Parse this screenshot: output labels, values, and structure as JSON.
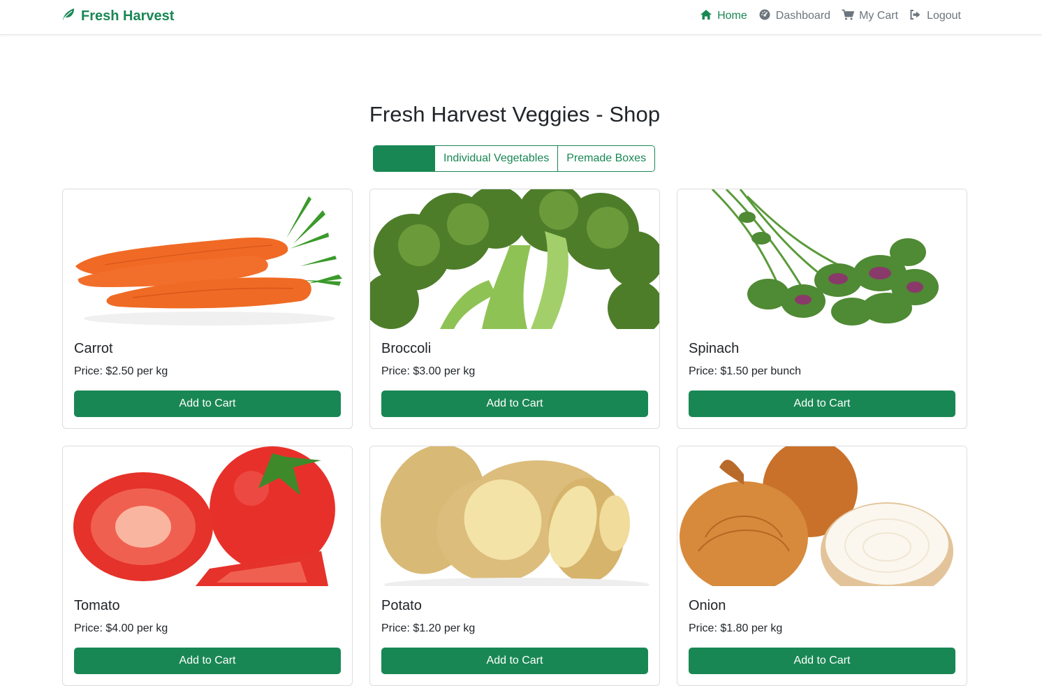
{
  "navbar": {
    "brand": "Fresh Harvest",
    "brand_icon": "leaf-icon",
    "links": [
      {
        "label": "Home",
        "icon": "home-icon",
        "active": true
      },
      {
        "label": "Dashboard",
        "icon": "dashboard-icon",
        "active": false
      },
      {
        "label": "My Cart",
        "icon": "cart-icon",
        "active": false
      },
      {
        "label": "Logout",
        "icon": "logout-icon",
        "active": false
      }
    ]
  },
  "page": {
    "title": "Fresh Harvest Veggies - Shop"
  },
  "filters": [
    {
      "label": "",
      "active": true
    },
    {
      "label": "Individual Vegetables",
      "active": false
    },
    {
      "label": "Premade Boxes",
      "active": false
    }
  ],
  "products": [
    {
      "name": "Carrot",
      "price": "Price: $2.50 per kg",
      "button": "Add to Cart"
    },
    {
      "name": "Broccoli",
      "price": "Price: $3.00 per kg",
      "button": "Add to Cart"
    },
    {
      "name": "Spinach",
      "price": "Price: $1.50 per bunch",
      "button": "Add to Cart"
    },
    {
      "name": "Tomato",
      "price": "Price: $4.00 per kg",
      "button": "Add to Cart"
    },
    {
      "name": "Potato",
      "price": "Price: $1.20 per kg",
      "button": "Add to Cart"
    },
    {
      "name": "Onion",
      "price": "Price: $1.80 per kg",
      "button": "Add to Cart"
    }
  ],
  "colors": {
    "brand": "#198754",
    "muted": "#6c757d",
    "text": "#212529"
  }
}
